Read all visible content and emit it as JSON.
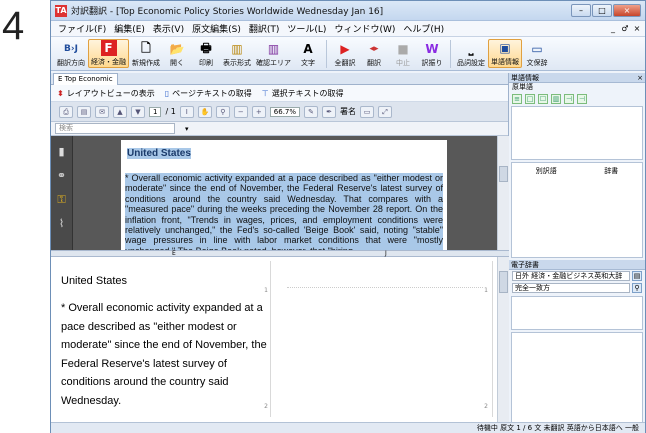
{
  "step_number": "4",
  "window": {
    "app_icon": "TA",
    "title": "対訳翻訳 - [Top Economic Policy Stories Worldwide Wednesday Jan 16]",
    "controls": [
      "–",
      "□",
      "×"
    ]
  },
  "menu": {
    "items": [
      "ファイル(F)",
      "編集(E)",
      "表示(V)",
      "原文編集(S)",
      "翻訳(T)",
      "ツール(L)",
      "ウィンドウ(W)",
      "ヘルプ(H)"
    ],
    "right": [
      "_",
      "♂",
      "×"
    ]
  },
  "toolbar": {
    "items": [
      {
        "icon": "B›J",
        "label": "翻訳方向"
      },
      {
        "icon": "F",
        "label": "経済・金融",
        "active": true
      },
      {
        "icon": "🗋",
        "label": "新規作成"
      },
      {
        "icon": "📂",
        "label": "開く"
      },
      {
        "icon": "🖶",
        "label": "印刷"
      },
      {
        "icon": "▥",
        "label": "表示形式"
      },
      {
        "icon": "▥",
        "label": "確認エリア"
      },
      {
        "icon": "A",
        "label": "文字"
      },
      {
        "icon": "▶",
        "label": "全翻訳"
      },
      {
        "icon": "◂▸",
        "label": "翻訳"
      },
      {
        "icon": "■",
        "label": "中止",
        "dim": true
      },
      {
        "icon": "W",
        "label": "訳振り"
      },
      {
        "icon": "⎵",
        "label": "品詞設定"
      },
      {
        "icon": "▣",
        "label": "単語情報"
      },
      {
        "icon": "▭",
        "label": "文保辞"
      }
    ]
  },
  "doc_tab": {
    "label": "E  Top Economic"
  },
  "nav": {
    "layout_label": "レイアウトビューの表示",
    "page_text_label": "ページテキストの取得",
    "selected_text_label": "選択テキストの取得"
  },
  "pdf_toolbar": {
    "page_current": "1",
    "page_total": "/ 1",
    "zoom": "66.7%",
    "sign_label": "署名"
  },
  "search": {
    "placeholder": "検索"
  },
  "document": {
    "heading": "United States",
    "paragraph": "* Overall economic activity expanded at a pace described as \"either modest or moderate\" since the end of November, the Federal Reserve's latest survey of conditions around the country said Wednesday. That compares with a \"measured pace\" during the weeks preceding the November 28 report. On the inflation front, \"Trends in wages, prices, and employment conditions were relatively unchanged,\" the Fed's so-called 'Beige Book' said, noting \"stable\" wage pressures in line with labor market conditions that were \"mostly unchanged.\" The Beige Book noted, however, that \"hiring"
  },
  "splitter": {
    "left_label": "E",
    "right_label": "J"
  },
  "source_panel": {
    "title": "United States",
    "body": "* Overall economic activity expanded at a pace described as \"either modest or moderate\" since the end of November, the Federal Reserve's latest survey of conditions around the country said Wednesday.",
    "num1": "1",
    "num2": "2"
  },
  "target_panel": {
    "num1": "1",
    "num2": "2"
  },
  "right_panel": {
    "word_info_header": "単語情報",
    "original_word_label": "原単語",
    "alt_word_label": "別訳語",
    "dictionary_label": "辞書",
    "edict_header": "電子辞書",
    "dict_select": "日外 経済・金融ビジネス英和大辞",
    "match_select": "完全一致方",
    "icons": [
      "≡",
      "□",
      "☐",
      "▥",
      "⊣",
      "⊣"
    ]
  },
  "status": {
    "text": "待機中  原文  1 / 6 文  未翻訳  英語から日本語へ  一般"
  }
}
